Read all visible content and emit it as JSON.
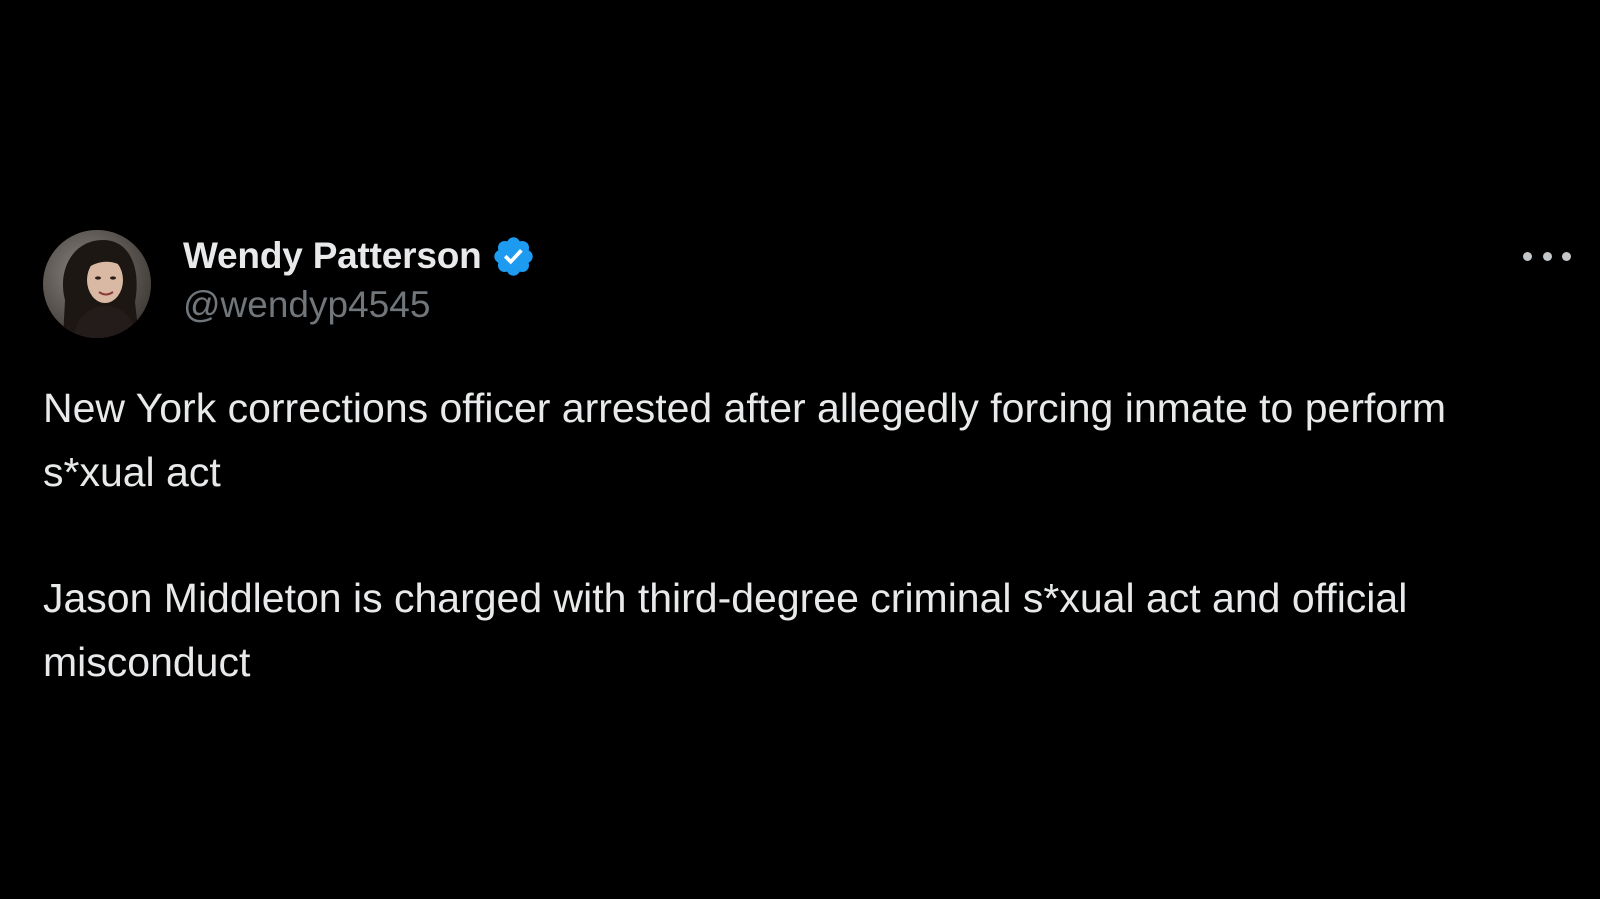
{
  "tweet": {
    "author": {
      "display_name": "Wendy Patterson",
      "handle": "@wendyp4545",
      "verified": true,
      "avatar_icon": "profile-photo"
    },
    "more_icon": "ellipsis-horizontal-icon",
    "paragraphs": [
      "New York corrections officer arrested after allegedly forcing inmate to perform s*xual act",
      "Jason Middleton is charged with third-degree criminal s*xual act and official misconduct"
    ]
  },
  "colors": {
    "background": "#000000",
    "text_primary": "#e7e9ea",
    "text_secondary": "#71767b",
    "verified_blue": "#1d9bf0"
  }
}
